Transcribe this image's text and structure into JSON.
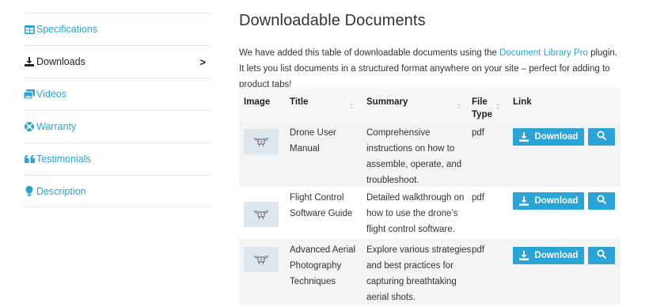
{
  "sidebar": {
    "items": [
      {
        "label": "Specifications",
        "icon": "table-icon"
      },
      {
        "label": "Downloads",
        "icon": "download-icon"
      },
      {
        "label": "Videos",
        "icon": "images-icon"
      },
      {
        "label": "Warranty",
        "icon": "lifebuoy-icon"
      },
      {
        "label": "Testimonials",
        "icon": "quote-icon"
      },
      {
        "label": "Description",
        "icon": "lightbulb-icon"
      }
    ],
    "active_chevron": ">"
  },
  "main": {
    "title": "Downloadable Documents",
    "intro_before": "We have added this table of downloadable documents using the ",
    "intro_link": "Document Library Pro",
    "intro_after": " plugin. It lets you list documents in a structured format anywhere on your site – perfect for adding to product tabs!"
  },
  "table": {
    "headers": {
      "image": "Image",
      "title": "Title",
      "summary": "Summary",
      "filetype_1": "File",
      "filetype_2": "Type",
      "link": "Link"
    },
    "rows": [
      {
        "title_lines": [
          "Drone User",
          "Manual"
        ],
        "summary_lines": [
          "Comprehensive",
          "instructions on how to",
          "assemble, operate, and",
          "troubleshoot."
        ],
        "file_type": "pdf",
        "download_label": "Download"
      },
      {
        "title_lines": [
          "Flight Control",
          "Software Guide"
        ],
        "summary_lines": [
          "Detailed walkthrough on",
          "how to use the drone’s",
          "flight control software."
        ],
        "file_type": "pdf",
        "download_label": "Download"
      },
      {
        "title_lines": [
          "Advanced Aerial",
          "Photography",
          "Techniques"
        ],
        "summary_lines": [
          "Explore various strategies",
          "and best practices for",
          "capturing breathtaking",
          "aerial shots."
        ],
        "file_type": "pdf",
        "download_label": "Download"
      }
    ]
  },
  "colors": {
    "accent": "#2aa3d6",
    "header_bg": "#f7f7f7",
    "row_stripe": "#f4f4f4"
  }
}
